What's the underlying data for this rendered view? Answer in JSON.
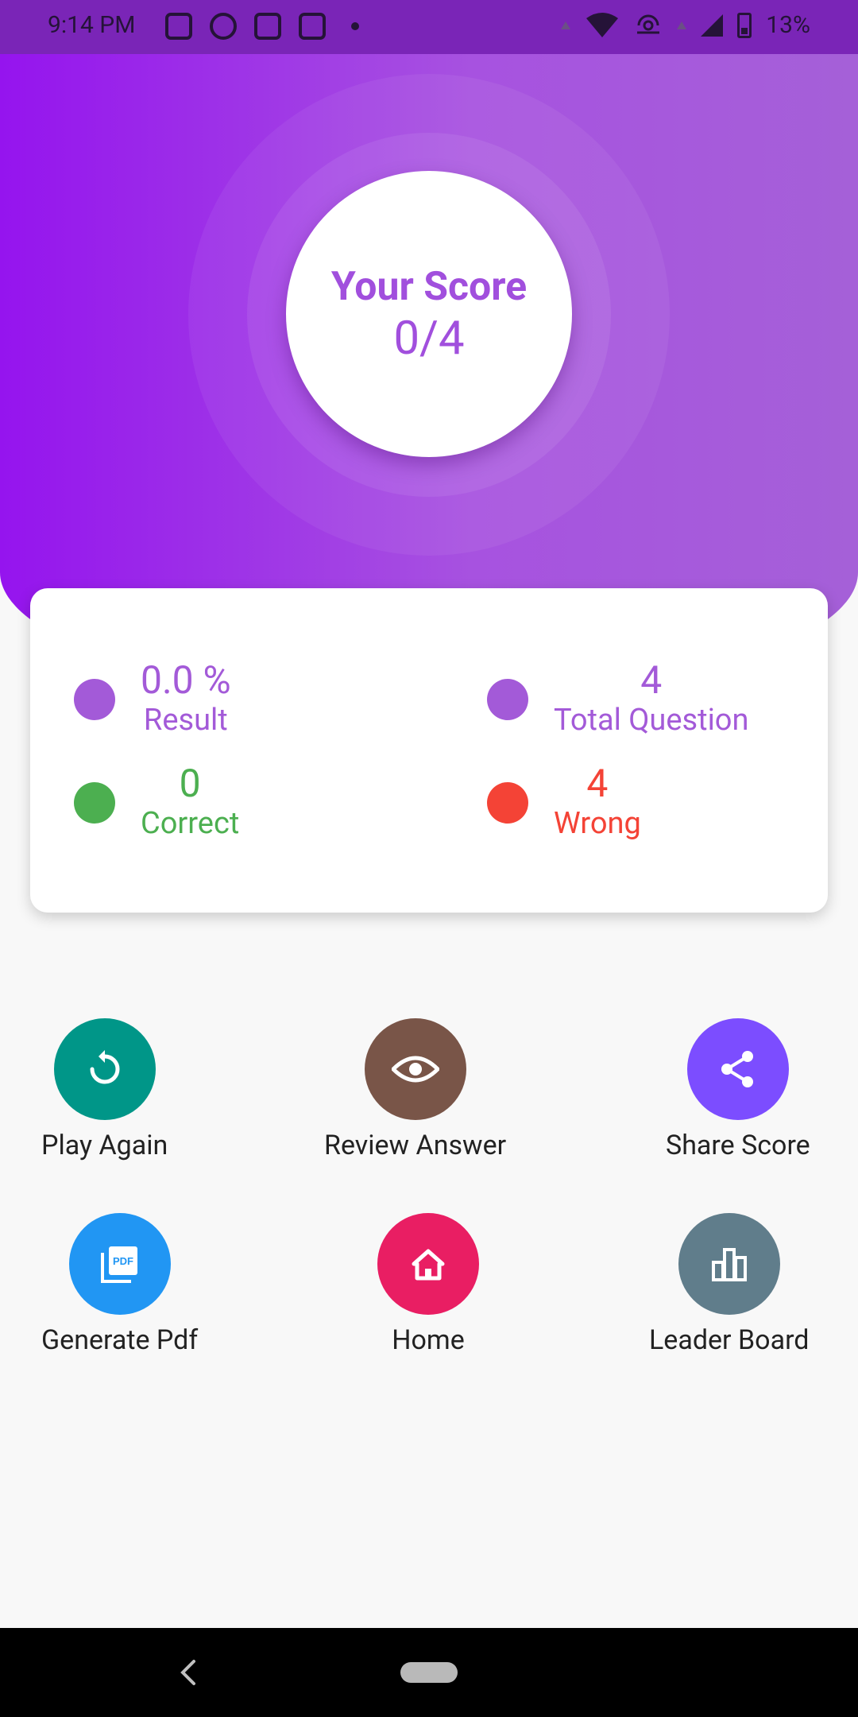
{
  "status_bar": {
    "time": "9:14 PM",
    "battery": "13%"
  },
  "score": {
    "label": "Your Score",
    "value": "0/4"
  },
  "stats": {
    "result": {
      "value": "0.0 %",
      "label": "Result",
      "color": "#a35ad8"
    },
    "total": {
      "value": "4",
      "label": "Total Question",
      "color": "#a35ad8"
    },
    "correct": {
      "value": "0",
      "label": "Correct",
      "color": "#4caf50"
    },
    "wrong": {
      "value": "4",
      "label": "Wrong",
      "color": "#f44336"
    }
  },
  "actions": [
    {
      "label": "Play Again",
      "icon": "replay-icon",
      "color": "#009688"
    },
    {
      "label": "Review Answer",
      "icon": "eye-icon",
      "color": "#795548"
    },
    {
      "label": "Share Score",
      "icon": "share-icon",
      "color": "#7c4dff"
    },
    {
      "label": "Generate Pdf",
      "icon": "pdf-icon",
      "color": "#2196f3"
    },
    {
      "label": "Home",
      "icon": "home-icon",
      "color": "#e91e63"
    },
    {
      "label": "Leader Board",
      "icon": "leaderboard-icon",
      "color": "#607d8b"
    }
  ]
}
